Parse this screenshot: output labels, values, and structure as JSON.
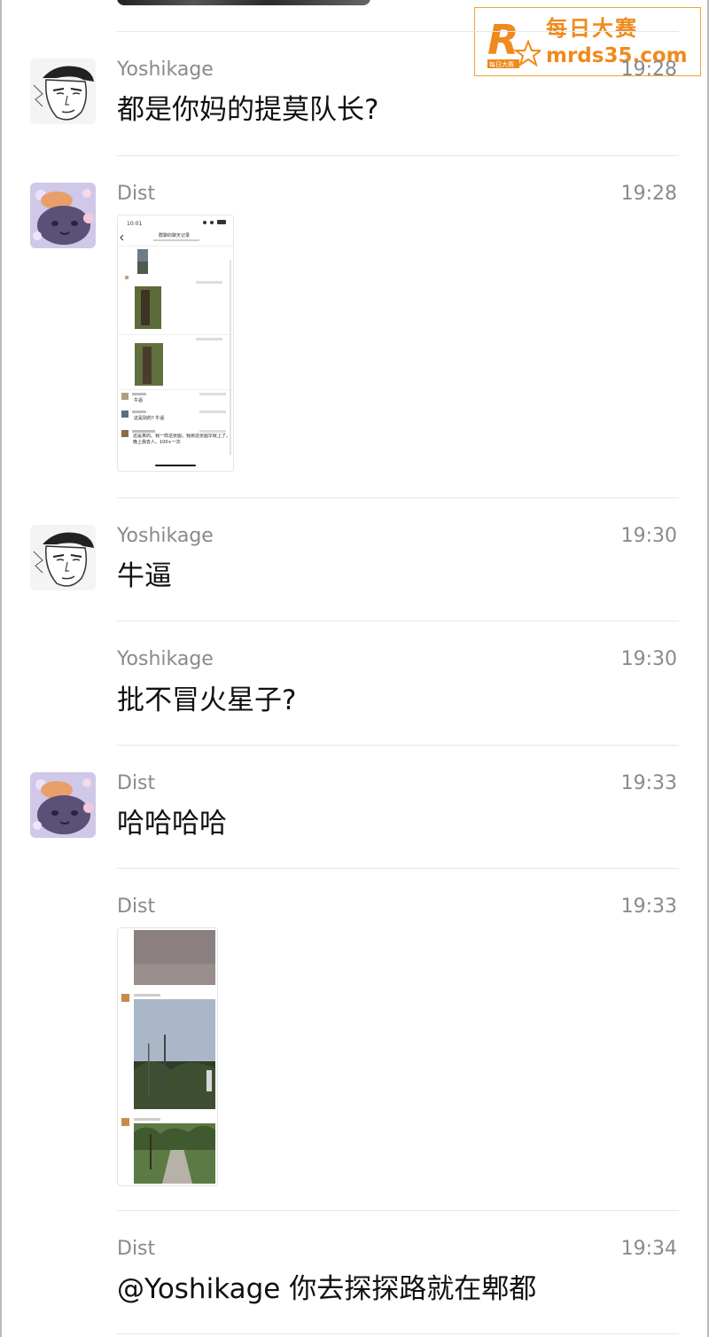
{
  "watermark": {
    "cn": "每日大赛",
    "url": "mrds35.com",
    "logo_letter": "R",
    "logo_small": "每日大赛"
  },
  "messages": [
    {
      "sender": "Yoshikage",
      "time": "19:28",
      "text": "都是你妈的提莫队长?"
    },
    {
      "sender": "Dist",
      "time": "19:28",
      "image": "screenshot-image"
    },
    {
      "sender": "Yoshikage",
      "time": "19:30",
      "text": "牛逼"
    },
    {
      "sender": "Yoshikage",
      "time": "19:30",
      "text": "批不冒火星子?"
    },
    {
      "sender": "Dist",
      "time": "19:33",
      "text": "哈哈哈哈"
    },
    {
      "sender": "Dist",
      "time": "19:33",
      "image": "photos-image"
    },
    {
      "sender": "Dist",
      "time": "19:34",
      "text": "@Yoshikage 你去探探路就在郫都"
    }
  ],
  "screenshot_inner": {
    "status_time": "10:01",
    "title": "群聊的聊天记录",
    "row1_text": "牛逼",
    "row2_text": "这是别的? 牛逼",
    "row3_text": "这是真的。我一样这张图，我那这张图早就上了。晚上我去人。100+一次"
  },
  "colors": {
    "accent": "#ef8a1c",
    "secondary_text": "#8a8a8a",
    "divider": "#e6e6e6"
  }
}
